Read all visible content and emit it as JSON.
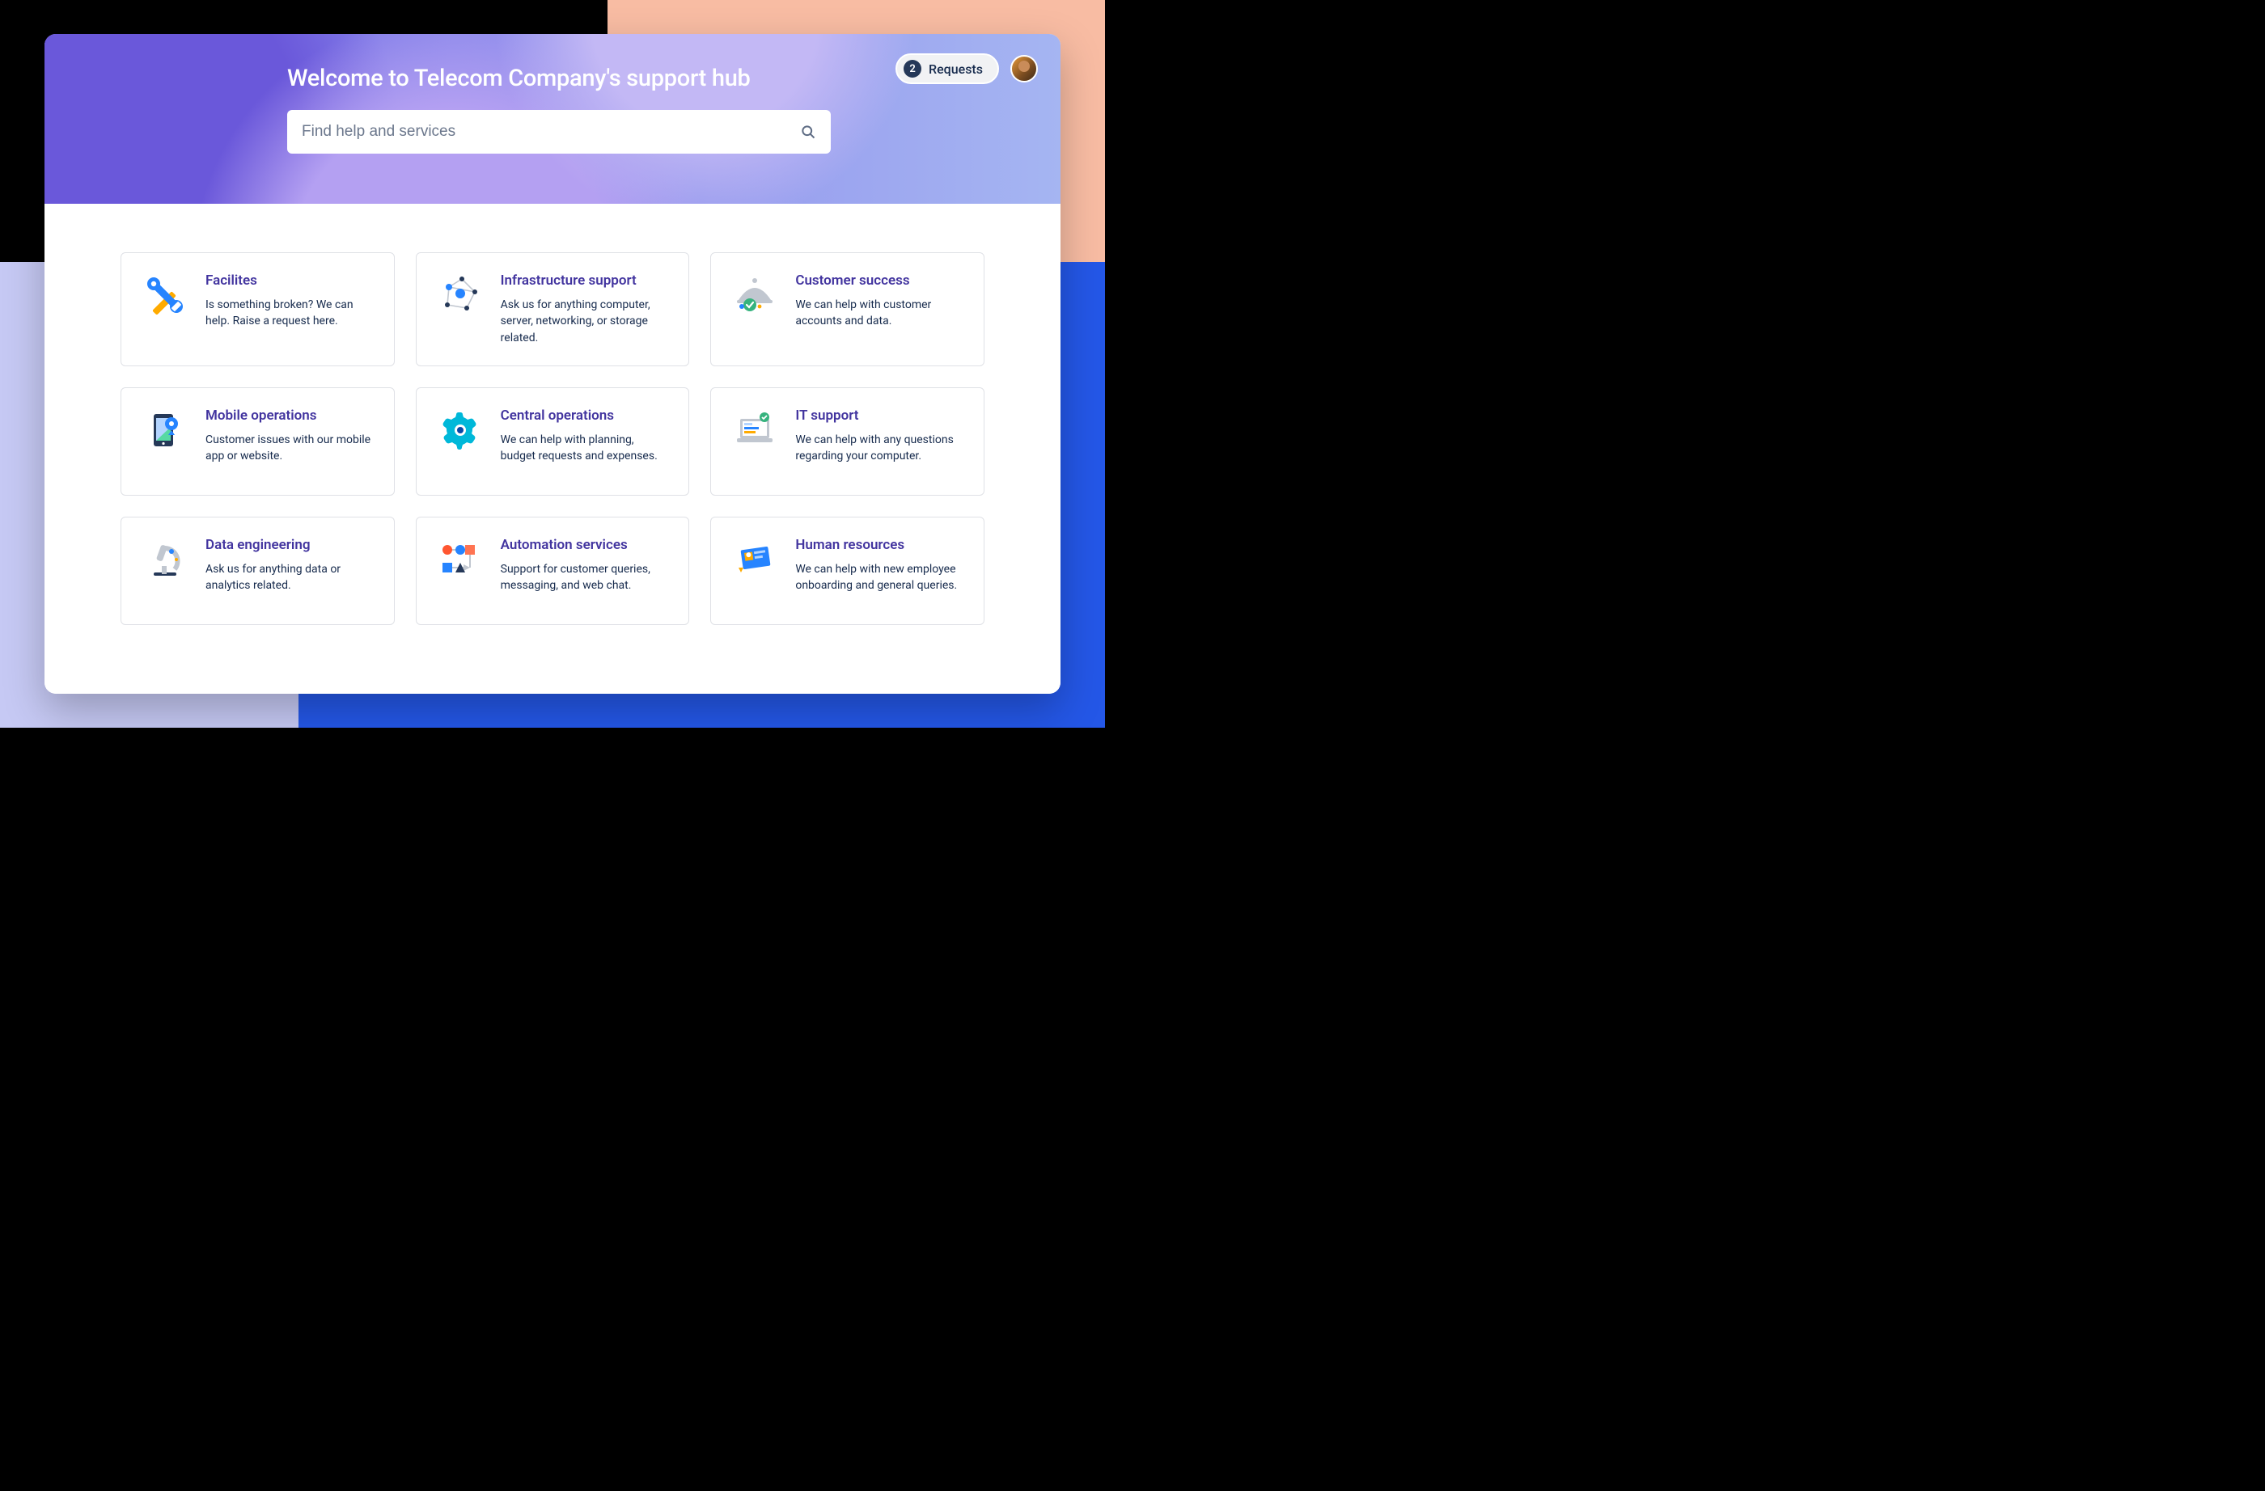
{
  "hero": {
    "title": "Welcome to Telecom Company's support hub",
    "search_placeholder": "Find help and services"
  },
  "header": {
    "requests_count": "2",
    "requests_label": "Requests"
  },
  "cards": [
    {
      "title": "Facilites",
      "desc": "Is something broken? We can help. Raise a request here.",
      "icon": "tools-icon"
    },
    {
      "title": "Infrastructure support",
      "desc": "Ask us for anything computer, server, networking, or storage related.",
      "icon": "network-icon"
    },
    {
      "title": "Customer success",
      "desc": "We can help with customer accounts and data.",
      "icon": "cloche-icon"
    },
    {
      "title": "Mobile operations",
      "desc": "Customer issues with our mobile app or website.",
      "icon": "mobile-icon"
    },
    {
      "title": "Central operations",
      "desc": "We can help with planning, budget requests and expenses.",
      "icon": "gear-icon"
    },
    {
      "title": "IT support",
      "desc": "We can help with any questions regarding your computer.",
      "icon": "laptop-icon"
    },
    {
      "title": "Data engineering",
      "desc": "Ask us for anything data or analytics related.",
      "icon": "microscope-icon"
    },
    {
      "title": "Automation services",
      "desc": "Support for customer queries, messaging, and web chat.",
      "icon": "flow-icon"
    },
    {
      "title": "Human resources",
      "desc": "We can help with new employee onboarding and general queries.",
      "icon": "idcard-icon"
    }
  ],
  "colors": {
    "brand_purple": "#42349F",
    "text": "#172B4D",
    "accent_blue": "#2684FF",
    "accent_teal": "#00B8D9",
    "accent_orange": "#FF991F",
    "accent_green": "#00875A"
  }
}
